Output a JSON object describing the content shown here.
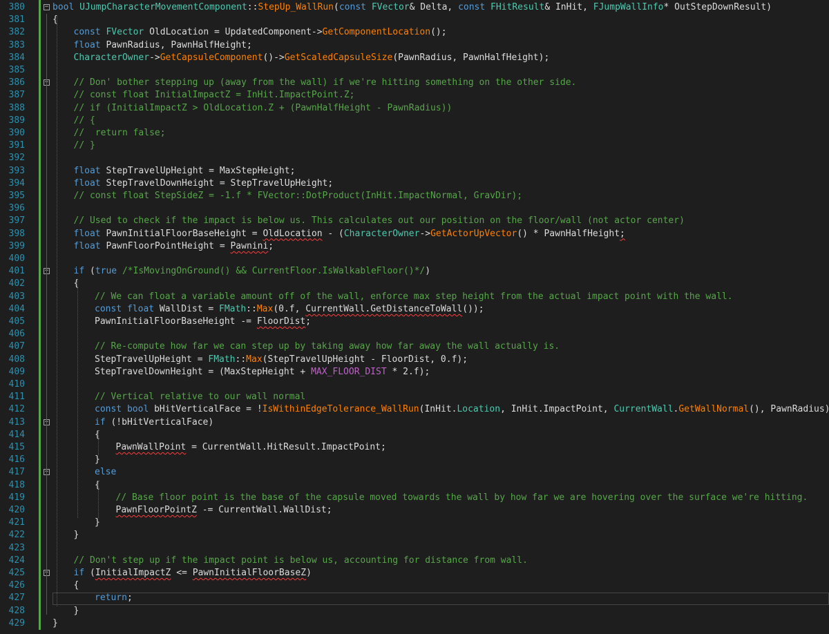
{
  "editor": {
    "lines": [
      {
        "n": "380",
        "fold": "−",
        "indent": 0,
        "tokens": [
          [
            "kw",
            "bool"
          ],
          [
            "plain",
            " "
          ],
          [
            "type",
            "UJumpCharacterMovementComponent"
          ],
          [
            "plain",
            "::"
          ],
          [
            "fn",
            "StepUp_WallRun"
          ],
          [
            "plain",
            "("
          ],
          [
            "kw",
            "const"
          ],
          [
            "plain",
            " "
          ],
          [
            "type",
            "FVector"
          ],
          [
            "plain",
            "& Delta, "
          ],
          [
            "kw",
            "const"
          ],
          [
            "plain",
            " "
          ],
          [
            "type",
            "FHitResult"
          ],
          [
            "plain",
            "& InHit, "
          ],
          [
            "type",
            "FJumpWallInfo"
          ],
          [
            "plain",
            "* OutStepDownResult)"
          ]
        ]
      },
      {
        "n": "381",
        "indent": 0,
        "tokens": [
          [
            "plain",
            "{"
          ]
        ]
      },
      {
        "n": "382",
        "indent": 1,
        "tokens": [
          [
            "kw",
            "const"
          ],
          [
            "plain",
            " "
          ],
          [
            "type",
            "FVector"
          ],
          [
            "plain",
            " OldLocation = UpdatedComponent->"
          ],
          [
            "fn",
            "GetComponentLocation"
          ],
          [
            "plain",
            "();"
          ]
        ]
      },
      {
        "n": "383",
        "indent": 1,
        "tokens": [
          [
            "kw",
            "float"
          ],
          [
            "plain",
            " PawnRadius, PawnHalfHeight;"
          ]
        ]
      },
      {
        "n": "384",
        "indent": 1,
        "tokens": [
          [
            "type",
            "CharacterOwner"
          ],
          [
            "plain",
            "->"
          ],
          [
            "fn",
            "GetCapsuleComponent"
          ],
          [
            "plain",
            "()->"
          ],
          [
            "fn",
            "GetScaledCapsuleSize"
          ],
          [
            "plain",
            "(PawnRadius, PawnHalfHeight);"
          ]
        ]
      },
      {
        "n": "385",
        "indent": 0,
        "tokens": []
      },
      {
        "n": "386",
        "fold": "−",
        "indent": 1,
        "tokens": [
          [
            "comment",
            "// Don' bother stepping up (away from the wall) if we're hitting something on the other side."
          ]
        ]
      },
      {
        "n": "387",
        "indent": 1,
        "tokens": [
          [
            "comment",
            "// const float InitialImpactZ = InHit.ImpactPoint.Z;"
          ]
        ]
      },
      {
        "n": "388",
        "indent": 1,
        "tokens": [
          [
            "comment",
            "// if (InitialImpactZ > OldLocation.Z + (PawnHalfHeight - PawnRadius))"
          ]
        ]
      },
      {
        "n": "389",
        "indent": 1,
        "tokens": [
          [
            "comment",
            "// {"
          ]
        ]
      },
      {
        "n": "390",
        "indent": 1,
        "tokens": [
          [
            "comment",
            "//  return false;"
          ]
        ]
      },
      {
        "n": "391",
        "indent": 1,
        "tokens": [
          [
            "comment",
            "// }"
          ]
        ]
      },
      {
        "n": "392",
        "indent": 0,
        "tokens": []
      },
      {
        "n": "393",
        "indent": 1,
        "tokens": [
          [
            "kw",
            "float"
          ],
          [
            "plain",
            " StepTravelUpHeight = MaxStepHeight;"
          ]
        ]
      },
      {
        "n": "394",
        "indent": 1,
        "tokens": [
          [
            "kw",
            "float"
          ],
          [
            "plain",
            " StepTravelDownHeight = StepTravelUpHeight;"
          ]
        ]
      },
      {
        "n": "395",
        "indent": 1,
        "tokens": [
          [
            "comment",
            "// const float StepSideZ = -1.f * FVector::DotProduct(InHit.ImpactNormal, GravDir);"
          ]
        ]
      },
      {
        "n": "396",
        "indent": 0,
        "tokens": []
      },
      {
        "n": "397",
        "indent": 1,
        "tokens": [
          [
            "comment",
            "// Used to check if the impact is below us. This calculates out our position on the floor/wall (not actor center)"
          ]
        ]
      },
      {
        "n": "398",
        "indent": 1,
        "tokens": [
          [
            "kw",
            "float"
          ],
          [
            "plain",
            " PawnInitialFloorBaseHeight = "
          ],
          [
            "squig",
            "OldLocation"
          ],
          [
            "plain",
            " - ("
          ],
          [
            "type",
            "CharacterOwner"
          ],
          [
            "plain",
            "->"
          ],
          [
            "fn",
            "GetActorUpVector"
          ],
          [
            "plain",
            "() * PawnHalfHeight"
          ],
          [
            "squig",
            ";"
          ]
        ]
      },
      {
        "n": "399",
        "indent": 1,
        "tokens": [
          [
            "kw",
            "float"
          ],
          [
            "plain",
            " PawnFloorPointHeight = "
          ],
          [
            "squig",
            "Pawnini"
          ],
          [
            "plain",
            ";"
          ]
        ]
      },
      {
        "n": "400",
        "indent": 0,
        "tokens": []
      },
      {
        "n": "401",
        "fold": "−",
        "indent": 1,
        "tokens": [
          [
            "kw",
            "if"
          ],
          [
            "plain",
            " ("
          ],
          [
            "kw",
            "true"
          ],
          [
            "plain",
            " "
          ],
          [
            "comment",
            "/*IsMovingOnGround() && CurrentFloor.IsWalkableFloor()*/"
          ],
          [
            "plain",
            ")"
          ]
        ]
      },
      {
        "n": "402",
        "indent": 1,
        "tokens": [
          [
            "plain",
            "{"
          ]
        ]
      },
      {
        "n": "403",
        "indent": 2,
        "tokens": [
          [
            "comment",
            "// We can float a variable amount off of the wall, enforce max step height from the actual impact point with the wall."
          ]
        ]
      },
      {
        "n": "404",
        "indent": 2,
        "tokens": [
          [
            "kw",
            "const"
          ],
          [
            "plain",
            " "
          ],
          [
            "kw",
            "float"
          ],
          [
            "plain",
            " WallDist = "
          ],
          [
            "type",
            "FMath"
          ],
          [
            "plain",
            "::"
          ],
          [
            "fn",
            "Max"
          ],
          [
            "plain",
            "(0.f, "
          ],
          [
            "squig",
            "CurrentWall.GetDistanceToWall"
          ],
          [
            "plain",
            "());"
          ]
        ]
      },
      {
        "n": "405",
        "indent": 2,
        "tokens": [
          [
            "plain",
            "PawnInitialFloorBaseHeight -= "
          ],
          [
            "squig",
            "FloorDist"
          ],
          [
            "plain",
            ";"
          ]
        ]
      },
      {
        "n": "406",
        "indent": 0,
        "tokens": []
      },
      {
        "n": "407",
        "indent": 2,
        "tokens": [
          [
            "comment",
            "// Re-compute how far we can step up by taking away how far away the wall actually is."
          ]
        ]
      },
      {
        "n": "408",
        "indent": 2,
        "tokens": [
          [
            "plain",
            "StepTravelUpHeight = "
          ],
          [
            "type",
            "FMath"
          ],
          [
            "plain",
            "::"
          ],
          [
            "fn",
            "Max"
          ],
          [
            "plain",
            "(StepTravelUpHeight - FloorDist, 0.f);"
          ]
        ]
      },
      {
        "n": "409",
        "indent": 2,
        "tokens": [
          [
            "plain",
            "StepTravelDownHeight = (MaxStepHeight + "
          ],
          [
            "macro",
            "MAX_FLOOR_DIST"
          ],
          [
            "plain",
            " * 2.f);"
          ]
        ]
      },
      {
        "n": "410",
        "indent": 0,
        "tokens": []
      },
      {
        "n": "411",
        "indent": 2,
        "tokens": [
          [
            "comment",
            "// Vertical relative to our wall normal"
          ]
        ]
      },
      {
        "n": "412",
        "indent": 2,
        "tokens": [
          [
            "kw",
            "const"
          ],
          [
            "plain",
            " "
          ],
          [
            "kw",
            "bool"
          ],
          [
            "plain",
            " bHitVerticalFace = !"
          ],
          [
            "fn",
            "IsWithinEdgeTolerance_WallRun"
          ],
          [
            "plain",
            "(InHit."
          ],
          [
            "type",
            "Location"
          ],
          [
            "plain",
            ", InHit.ImpactPoint, "
          ],
          [
            "type",
            "CurrentWall"
          ],
          [
            "plain",
            "."
          ],
          [
            "fn",
            "GetWallNormal"
          ],
          [
            "plain",
            "(), PawnRadius);"
          ]
        ]
      },
      {
        "n": "413",
        "fold": "−",
        "indent": 2,
        "tokens": [
          [
            "kw",
            "if"
          ],
          [
            "plain",
            " (!bHitVerticalFace)"
          ]
        ]
      },
      {
        "n": "414",
        "indent": 2,
        "tokens": [
          [
            "plain",
            "{"
          ]
        ]
      },
      {
        "n": "415",
        "indent": 3,
        "tokens": [
          [
            "squig",
            "PawnWallPoint"
          ],
          [
            "plain",
            " = CurrentWall.HitResult.ImpactPoint;"
          ]
        ]
      },
      {
        "n": "416",
        "indent": 2,
        "tokens": [
          [
            "plain",
            "}"
          ]
        ]
      },
      {
        "n": "417",
        "fold": "−",
        "indent": 2,
        "tokens": [
          [
            "kw",
            "else"
          ]
        ]
      },
      {
        "n": "418",
        "indent": 2,
        "tokens": [
          [
            "plain",
            "{"
          ]
        ]
      },
      {
        "n": "419",
        "indent": 3,
        "tokens": [
          [
            "comment",
            "// Base floor point is the base of the capsule moved towards the wall by how far we are hovering over the surface we're hitting."
          ]
        ]
      },
      {
        "n": "420",
        "indent": 3,
        "tokens": [
          [
            "squig",
            "PawnFloorPointZ"
          ],
          [
            "plain",
            " -= CurrentWall.WallDist;"
          ]
        ]
      },
      {
        "n": "421",
        "indent": 2,
        "tokens": [
          [
            "plain",
            "}"
          ]
        ]
      },
      {
        "n": "422",
        "indent": 1,
        "tokens": [
          [
            "plain",
            "}"
          ]
        ]
      },
      {
        "n": "423",
        "indent": 0,
        "tokens": []
      },
      {
        "n": "424",
        "indent": 1,
        "tokens": [
          [
            "comment",
            "// Don't step up if the impact point is below us, accounting for distance from wall."
          ]
        ]
      },
      {
        "n": "425",
        "fold": "−",
        "indent": 1,
        "tokens": [
          [
            "kw",
            "if"
          ],
          [
            "plain",
            " ("
          ],
          [
            "squig",
            "InitialImpactZ"
          ],
          [
            "plain",
            " <= "
          ],
          [
            "squig",
            "PawnInitialFloorBaseZ"
          ],
          [
            "plain",
            ")"
          ]
        ]
      },
      {
        "n": "426",
        "indent": 1,
        "tokens": [
          [
            "plain",
            "{"
          ]
        ]
      },
      {
        "n": "427",
        "indent": 2,
        "tokens": [
          [
            "kw",
            "return"
          ],
          [
            "plain",
            ";"
          ]
        ]
      },
      {
        "n": "428",
        "indent": 1,
        "tokens": [
          [
            "plain",
            "}"
          ]
        ]
      },
      {
        "n": "429",
        "indent": 0,
        "tokens": [
          [
            "plain",
            "}"
          ]
        ]
      }
    ]
  },
  "colors": {
    "background": "#1e1e1e",
    "line_number": "#2b91af",
    "keyword": "#569cd6",
    "type": "#4ec9b0",
    "function": "#ff8000",
    "comment": "#57a64a",
    "macro": "#bd63c5",
    "error_squiggle": "#ff3c3c",
    "change_bar": "#57a64a"
  },
  "icons": {
    "fold": "collapse-minus-icon"
  }
}
